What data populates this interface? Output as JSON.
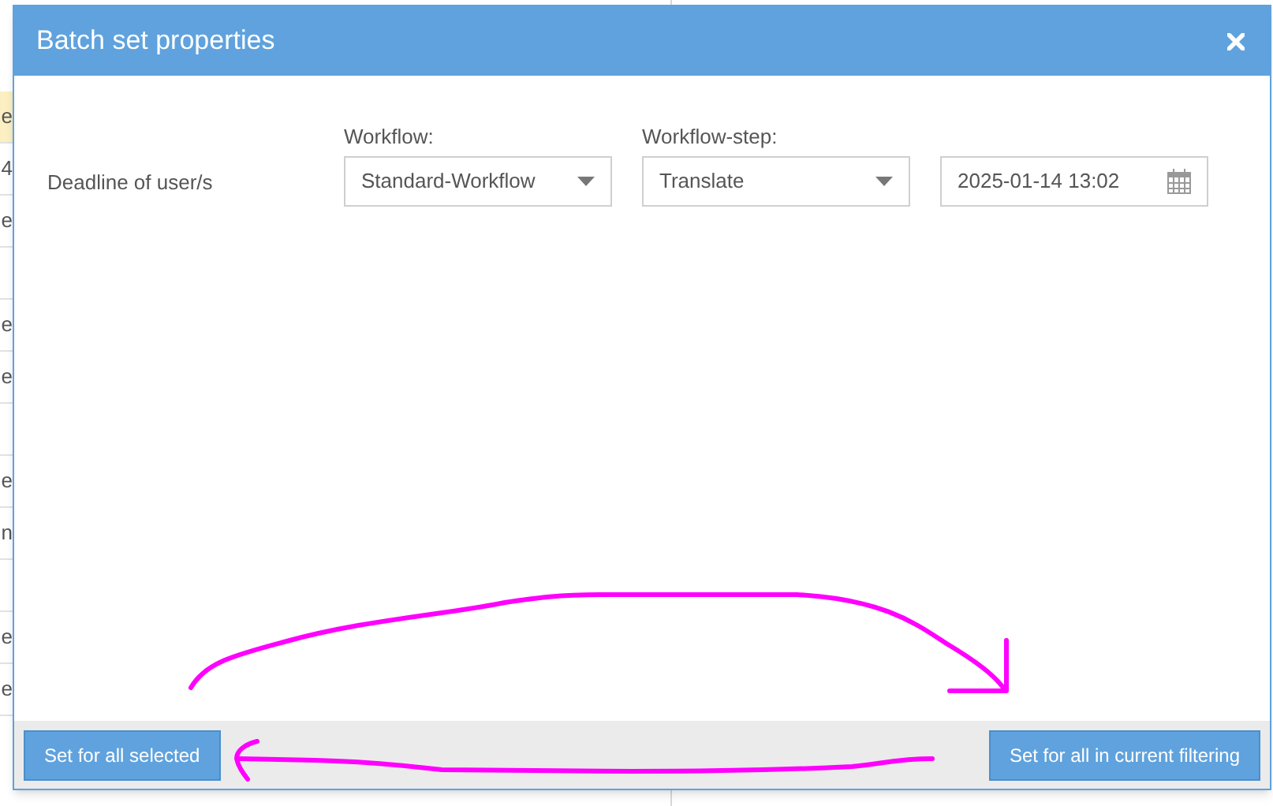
{
  "background": {
    "rows": [
      {
        "text": "e",
        "highlighted": true
      },
      {
        "text": "4",
        "highlighted": false
      },
      {
        "text": "e",
        "highlighted": false
      },
      {
        "highlighted": false
      },
      {
        "text": "e",
        "highlighted": false
      },
      {
        "text": "e",
        "highlighted": false
      },
      {
        "highlighted": false
      },
      {
        "text": "e",
        "highlighted": false
      },
      {
        "text": "n",
        "highlighted": false
      },
      {
        "highlighted": false
      },
      {
        "text": "e",
        "highlighted": false
      },
      {
        "text": "e",
        "highlighted": false
      }
    ]
  },
  "dialog": {
    "title": "Batch set properties",
    "row_label": "Deadline of user/s",
    "fields": [
      {
        "kind": "select",
        "label": "Workflow:",
        "value": "Standard-Workflow"
      },
      {
        "kind": "select",
        "label": "Workflow-step:",
        "value": "Translate"
      },
      {
        "kind": "date",
        "value": "2025-01-14 13:02"
      }
    ],
    "buttons": [
      "Set for all selected",
      "Set for all in current filtering"
    ]
  }
}
